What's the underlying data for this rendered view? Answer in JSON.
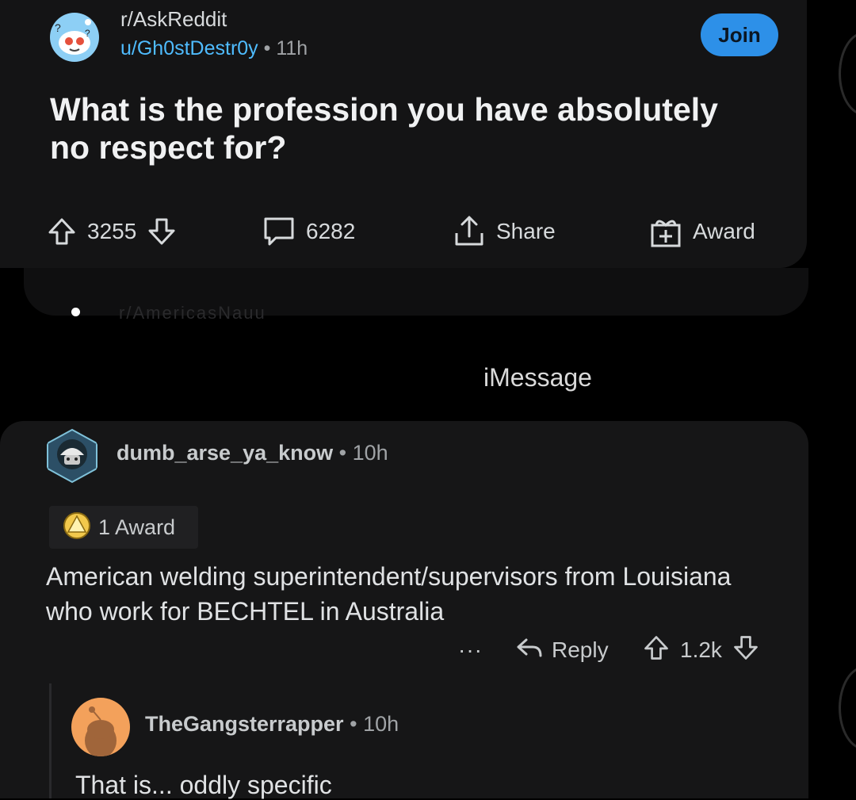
{
  "post": {
    "subreddit": "r/AskReddit",
    "author": "u/Gh0stDestr0y",
    "separator": "•",
    "age": "11h",
    "join_label": "Join",
    "title": "What is the profession you have absolutely no respect for?",
    "score": "3255",
    "comments": "6282",
    "share_label": "Share",
    "award_label": "Award"
  },
  "peek_text": "r/AmericasNauu",
  "imessage_label": "iMessage",
  "comment": {
    "author": "dumb_arse_ya_know",
    "separator": "•",
    "age": "10h",
    "award_chip": "1 Award",
    "body": "American welding superintendent/supervisors from Louisiana who work for BECHTEL in Australia",
    "more_label": "···",
    "reply_label": "Reply",
    "score": "1.2k"
  },
  "reply": {
    "author": "TheGangsterrapper",
    "separator": "•",
    "age": "10h",
    "body": "That is... oddly specific"
  },
  "colors": {
    "accent_blue": "#2d90e8",
    "username_blue": "#4fbcff",
    "background": "#000000",
    "card": "#141415"
  }
}
